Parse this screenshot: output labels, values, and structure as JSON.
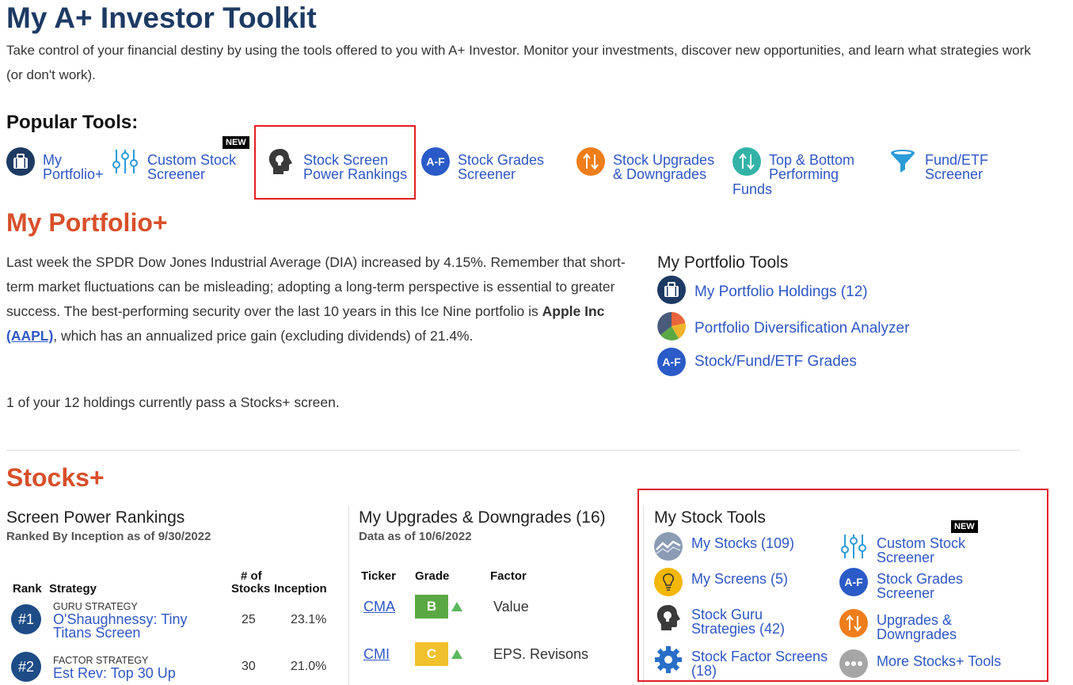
{
  "page": {
    "title": "My A+ Investor Toolkit",
    "intro": "Take control of your financial destiny by using the tools offered to you with A+ Investor. Monitor your investments, discover new opportunities, and learn what strategies work (or don't work)."
  },
  "popular": {
    "heading": "Popular Tools:",
    "new_badge": "NEW",
    "tools": [
      {
        "line1": "My",
        "line2": "Portfolio+",
        "icon": "briefcase-icon"
      },
      {
        "line1": "Custom Stock",
        "line2": "Screener",
        "icon": "sliders-icon"
      },
      {
        "line1": "Stock Screen",
        "line2": "Power Rankings",
        "icon": "head-bulb-icon"
      },
      {
        "line1": "Stock Grades",
        "line2": "Screener",
        "icon": "grades-icon",
        "icon_text": "A-F"
      },
      {
        "line1": "Stock Upgrades",
        "line2": "& Downgrades",
        "icon": "up-down-arrows-icon"
      },
      {
        "line1": "Top & Bottom",
        "line2": "Performing",
        "line3": "Funds",
        "icon": "updown-teal-icon"
      },
      {
        "line1": "Fund/ETF",
        "line2": "Screener",
        "icon": "funnel-icon"
      }
    ]
  },
  "portfolio": {
    "title": "My Portfolio+",
    "text_1": "Last week the SPDR Dow Jones Industrial Average (DIA) increased by 4.15%. Remember that short-term market fluctuations can be misleading; adopting a long-term perspective is essential to greater success. The best-performing security over the last 10 years in this Ice Nine portfolio is ",
    "company": "Apple Inc",
    "ticker": "(AAPL)",
    "text_2": ", which has an annualized price gain (excluding dividends) of 21.4%.",
    "pass_text": "1 of your 12 holdings currently pass a Stocks+ screen.",
    "tools_heading": "My Portfolio Tools",
    "tools": [
      {
        "label": "My Portfolio Holdings (12)",
        "icon": "briefcase-icon"
      },
      {
        "label": "Portfolio Diversification Analyzer",
        "icon": "pie-chart-icon"
      },
      {
        "label": "Stock/Fund/ETF Grades",
        "icon": "grades-icon",
        "icon_text": "A-F"
      }
    ]
  },
  "stocks": {
    "title": "Stocks+",
    "rankings": {
      "heading": "Screen Power Rankings",
      "subheading": "Ranked By Inception as of 9/30/2022",
      "col_rank": "Rank",
      "col_strategy": "Strategy",
      "col_num_1": "# of",
      "col_num_2": "Stocks",
      "col_inception": "Inception",
      "rows": [
        {
          "rank": "#1",
          "type": "GURU STRATEGY",
          "name_1": "O'Shaughnessy: Tiny",
          "name_2": "Titans Screen",
          "stocks": "25",
          "inception": "23.1%"
        },
        {
          "rank": "#2",
          "type": "FACTOR STRATEGY",
          "name_1": "Est Rev: Top 30 Up",
          "name_2": "",
          "stocks": "30",
          "inception": "21.0%"
        }
      ]
    },
    "upgrades": {
      "heading": "My Upgrades & Downgrades (16)",
      "subheading": "Data as of 10/6/2022",
      "col_ticker": "Ticker",
      "col_grade": "Grade",
      "col_factor": "Factor",
      "rows": [
        {
          "ticker": "CMA",
          "grade": "B",
          "grade_color": "#5aa843",
          "factor": "Value"
        },
        {
          "ticker": "CMI",
          "grade": "C",
          "grade_color": "#f0c12c",
          "factor": "EPS. Revisons"
        }
      ]
    },
    "tools": {
      "heading": "My Stock Tools",
      "new_badge": "NEW",
      "items": [
        {
          "line1": "My Stocks (109)",
          "line2": "",
          "icon": "stocks-chart-icon"
        },
        {
          "line1": "Custom Stock",
          "line2": "Screener",
          "icon": "sliders-icon"
        },
        {
          "line1": "My Screens (5)",
          "line2": "",
          "icon": "lightbulb-icon"
        },
        {
          "line1": "Stock Grades",
          "line2": "Screener",
          "icon": "grades-icon",
          "icon_text": "A-F"
        },
        {
          "line1": "Stock Guru",
          "line2": "Strategies (42)",
          "icon": "head-bulb-icon"
        },
        {
          "line1": "Upgrades &",
          "line2": "Downgrades",
          "icon": "up-down-arrows-icon"
        },
        {
          "line1": "Stock Factor Screens",
          "line2": "(18)",
          "icon": "gear-icon"
        },
        {
          "line1": "More Stocks+ Tools",
          "line2": "",
          "icon": "more-dots-icon"
        }
      ]
    }
  }
}
